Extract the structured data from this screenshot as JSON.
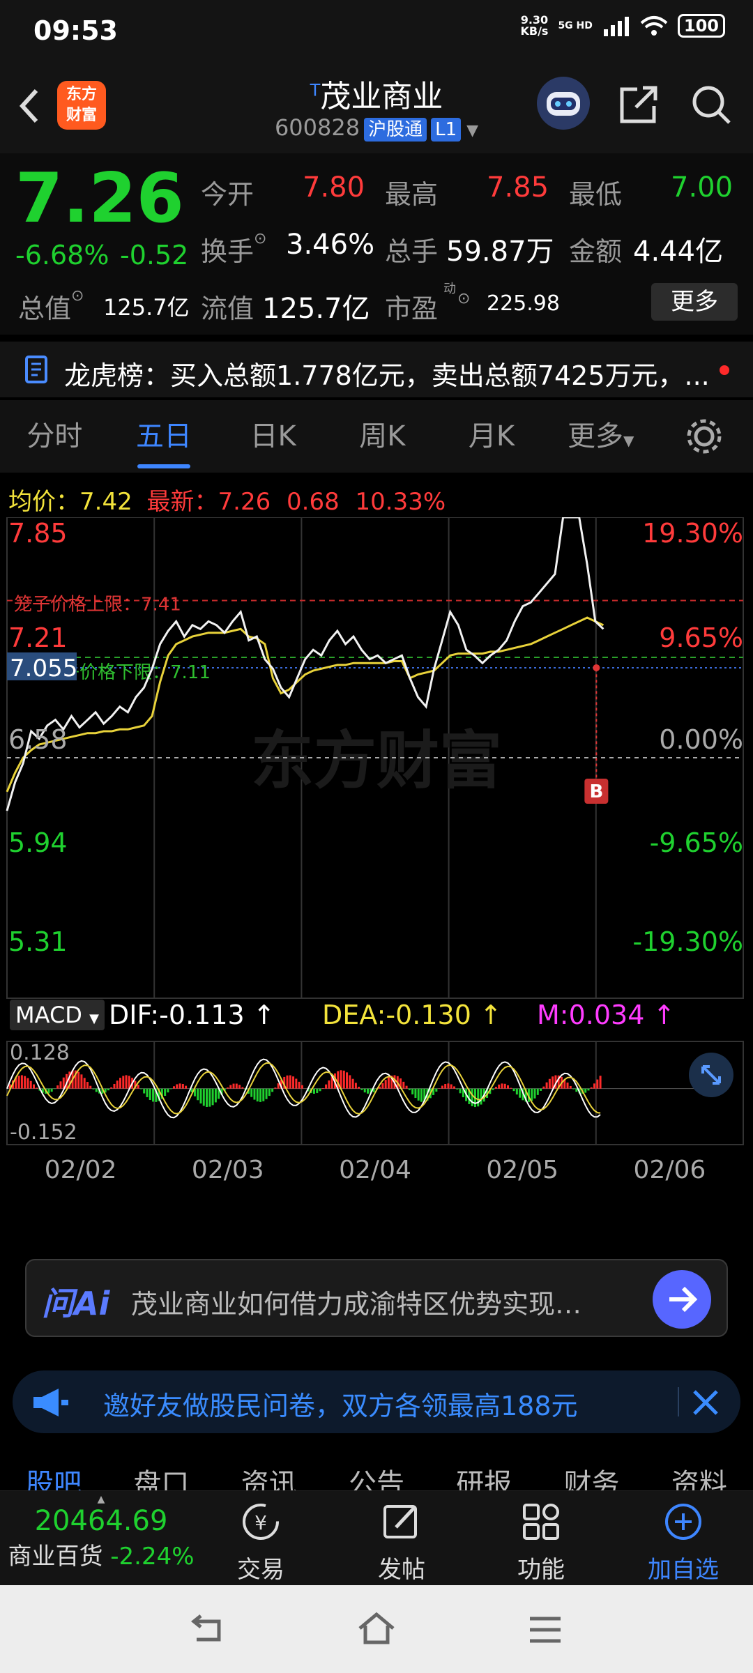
{
  "status": {
    "time": "09:53",
    "net_speed_top": "9.30",
    "net_speed_unit": "KB/s",
    "network": "5G HD",
    "battery": "100"
  },
  "header": {
    "logo_line1": "东方",
    "logo_line2": "财富",
    "title_prefix": "T",
    "title": "茂业商业",
    "code": "600828",
    "market_tag": "沪股通",
    "level_tag": "L1"
  },
  "quote": {
    "price": "7.26",
    "change_pct": "-6.68%",
    "change": "-0.52",
    "rows": [
      [
        {
          "label": "今开",
          "value": "7.80",
          "color": "red"
        },
        {
          "label": "最高",
          "value": "7.85",
          "color": "red"
        },
        {
          "label": "最低",
          "value": "7.00",
          "color": "green"
        }
      ],
      [
        {
          "label": "换手",
          "value": "3.46%",
          "color": "white"
        },
        {
          "label": "总手",
          "value": "59.87万",
          "color": "white"
        },
        {
          "label": "金额",
          "value": "4.44亿",
          "color": "white"
        }
      ],
      [
        {
          "label": "总值",
          "value": "125.7亿",
          "color": "white"
        },
        {
          "label": "流值",
          "value": "125.7亿",
          "color": "white"
        },
        {
          "label": "市盈",
          "value": "225.98",
          "color": "white"
        }
      ]
    ],
    "pe_sup": "动",
    "more_label": "更多"
  },
  "dragon": {
    "label": "龙虎榜：",
    "text": "买入总额1.778亿元，卖出总额7425万元，..."
  },
  "tabs": [
    "分时",
    "五日",
    "日K",
    "周K",
    "月K",
    "更多"
  ],
  "active_tab": 1,
  "chart_data": [
    {
      "type": "line",
      "title": "",
      "legend": {
        "avg_label": "均价：",
        "avg_value": "7.42",
        "latest_label": "最新：",
        "latest_value": "7.26",
        "latest_change": "0.68",
        "latest_pct": "10.33%"
      },
      "left_ticks": [
        "7.85",
        "7.21",
        "6.58",
        "5.94",
        "5.31"
      ],
      "right_ticks": [
        "19.30%",
        "9.65%",
        "0.00%",
        "-9.65%",
        "-19.30%"
      ],
      "ylim": [
        5.31,
        7.85
      ],
      "prev_close": 6.58,
      "cursor_price": "7.055",
      "cage_upper": {
        "label": "笼子价格上限：7.41",
        "value": 7.41
      },
      "cage_lower": {
        "label": "笼子价格下限：7.11",
        "value": 7.11
      },
      "days": [
        "02/02",
        "02/03",
        "02/04",
        "02/05",
        "02/06"
      ],
      "watermark": "东方财富",
      "signal": "B",
      "series": [
        {
          "name": "价格",
          "values": [
            6.3,
            6.45,
            6.55,
            6.72,
            6.68,
            6.75,
            6.78,
            6.73,
            6.8,
            6.74,
            6.78,
            6.82,
            6.76,
            6.8,
            6.85,
            6.82,
            6.9,
            6.95,
            7.05,
            7.18,
            7.25,
            7.3,
            7.22,
            7.28,
            7.26,
            7.3,
            7.28,
            7.24,
            7.3,
            7.35,
            7.2,
            7.22,
            7.1,
            7.05,
            6.95,
            6.9,
            7.0,
            7.1,
            7.15,
            7.12,
            7.2,
            7.25,
            7.18,
            7.22,
            7.15,
            7.1,
            7.12,
            7.08,
            7.1,
            7.12,
            7.0,
            6.9,
            6.85,
            7.05,
            7.2,
            7.35,
            7.28,
            7.15,
            7.12,
            7.08,
            7.12,
            7.15,
            7.2,
            7.3,
            7.38,
            7.4,
            7.45,
            7.5,
            7.55,
            7.85,
            7.85,
            7.85,
            7.6,
            7.3,
            7.26
          ]
        },
        {
          "name": "均价",
          "values": [
            6.4,
            6.5,
            6.58,
            6.62,
            6.65,
            6.66,
            6.67,
            6.68,
            6.69,
            6.7,
            6.71,
            6.71,
            6.72,
            6.72,
            6.73,
            6.73,
            6.74,
            6.75,
            6.8,
            6.98,
            7.12,
            7.18,
            7.2,
            7.22,
            7.23,
            7.24,
            7.24,
            7.24,
            7.25,
            7.26,
            7.22,
            7.21,
            7.18,
            7.0,
            6.92,
            6.94,
            6.98,
            7.02,
            7.04,
            7.05,
            7.06,
            7.07,
            7.07,
            7.08,
            7.08,
            7.08,
            7.08,
            7.08,
            7.09,
            7.09,
            7.0,
            7.02,
            7.03,
            7.04,
            7.08,
            7.12,
            7.13,
            7.13,
            7.13,
            7.13,
            7.14,
            7.14,
            7.15,
            7.16,
            7.17,
            7.18,
            7.2,
            7.22,
            7.24,
            7.26,
            7.28,
            7.3,
            7.32,
            7.3,
            7.28
          ]
        }
      ]
    },
    {
      "type": "bar",
      "indicator": "MACD",
      "dif": "DIF:-0.113 ↑",
      "dea": "DEA:-0.130 ↑",
      "m": "M:0.034 ↑",
      "ymax_label": "0.128",
      "ymin_label": "-0.152",
      "ylim": [
        -0.152,
        0.128
      ]
    }
  ],
  "ai": {
    "label": "问Ai",
    "text": "茂业商业如何借力成渝特区优势实现…"
  },
  "invite": {
    "text": "邀好友做股民问卷，双方各领最高188元"
  },
  "subtabs": [
    "股吧",
    "盘口",
    "资讯",
    "公告",
    "研报",
    "财务",
    "资料"
  ],
  "bottom": {
    "index_value": "20464.69",
    "index_name": "商业百货",
    "index_pct": "-2.24%",
    "items": [
      "交易",
      "发帖",
      "功能",
      "加自选"
    ]
  }
}
